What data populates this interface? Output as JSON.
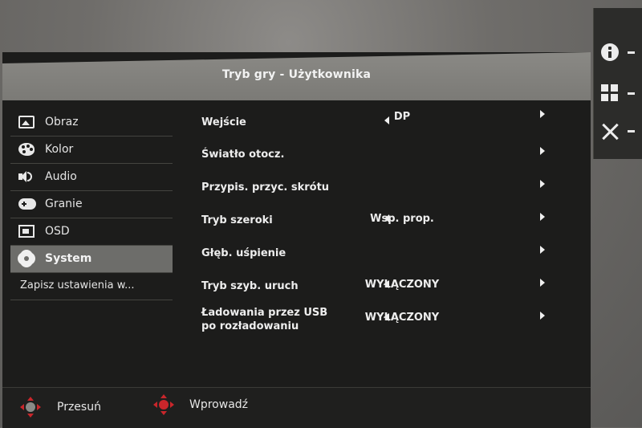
{
  "header": {
    "title": "Tryb gry - Użytkownika"
  },
  "hotkeys": [
    {
      "icon": "info-icon"
    },
    {
      "icon": "grid-icon"
    },
    {
      "icon": "close-icon"
    }
  ],
  "sidebar": {
    "items": [
      {
        "label": "Obraz",
        "icon": "image-icon"
      },
      {
        "label": "Kolor",
        "icon": "palette-icon"
      },
      {
        "label": "Audio",
        "icon": "speaker-icon"
      },
      {
        "label": "Granie",
        "icon": "gamepad-icon"
      },
      {
        "label": "OSD",
        "icon": "osd-icon"
      },
      {
        "label": "System",
        "icon": "gear-icon",
        "active": true
      }
    ],
    "save_label": "Zapisz ustawienia w..."
  },
  "settings": {
    "rows": [
      {
        "label": "Wejście",
        "value": "DP",
        "left_arrow": true,
        "right_arrow": true
      },
      {
        "label": "Światło otocz.",
        "value": "",
        "left_arrow": false,
        "right_arrow": true
      },
      {
        "label": "Przypis. przyc. skrótu",
        "value": "",
        "left_arrow": false,
        "right_arrow": true
      },
      {
        "label": "Tryb szeroki",
        "value": "Wsp. prop.",
        "left_arrow": true,
        "right_arrow": true
      },
      {
        "label": "Głęb. uśpienie",
        "value": "",
        "left_arrow": false,
        "right_arrow": true
      },
      {
        "label": "Tryb szyb. uruch",
        "value": "WYŁĄCZONY",
        "left_arrow": true,
        "right_arrow": true
      },
      {
        "label_line1": "Ładowania przez USB",
        "label_line2": "po rozładowaniu",
        "value": "WYŁĄCZONY",
        "left_arrow": true,
        "right_arrow": true
      }
    ]
  },
  "footer": {
    "move_label": "Przesuń",
    "enter_label": "Wprowadź"
  },
  "colors": {
    "accent_red": "#c9262b",
    "active_item_bg": "#6d6d6a",
    "panel_bg": "#1c1c1b",
    "header_bg": "#8a8985"
  }
}
